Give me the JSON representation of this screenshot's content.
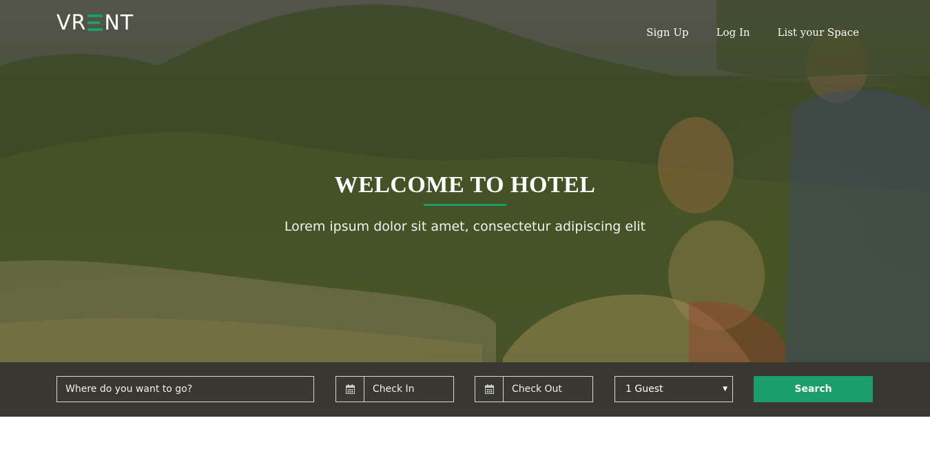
{
  "brand": {
    "logo_left": "VR",
    "logo_right": "NT",
    "accent_color": "#1a9e6a"
  },
  "nav": {
    "items": [
      {
        "label": "Sign Up"
      },
      {
        "label": "Log In"
      },
      {
        "label": "List your Space"
      }
    ]
  },
  "hero": {
    "title": "WELCOME TO HOTEL",
    "subtitle": "Lorem ipsum dolor sit amet, consectetur adipiscing elit"
  },
  "search": {
    "where_placeholder": "Where do you want to go?",
    "checkin_placeholder": "Check In",
    "checkout_placeholder": "Check Out",
    "guests_selected": "1 Guest",
    "button_label": "Search",
    "calendar_icon": "calendar-icon",
    "dropdown_icon": "caret-down-icon"
  }
}
